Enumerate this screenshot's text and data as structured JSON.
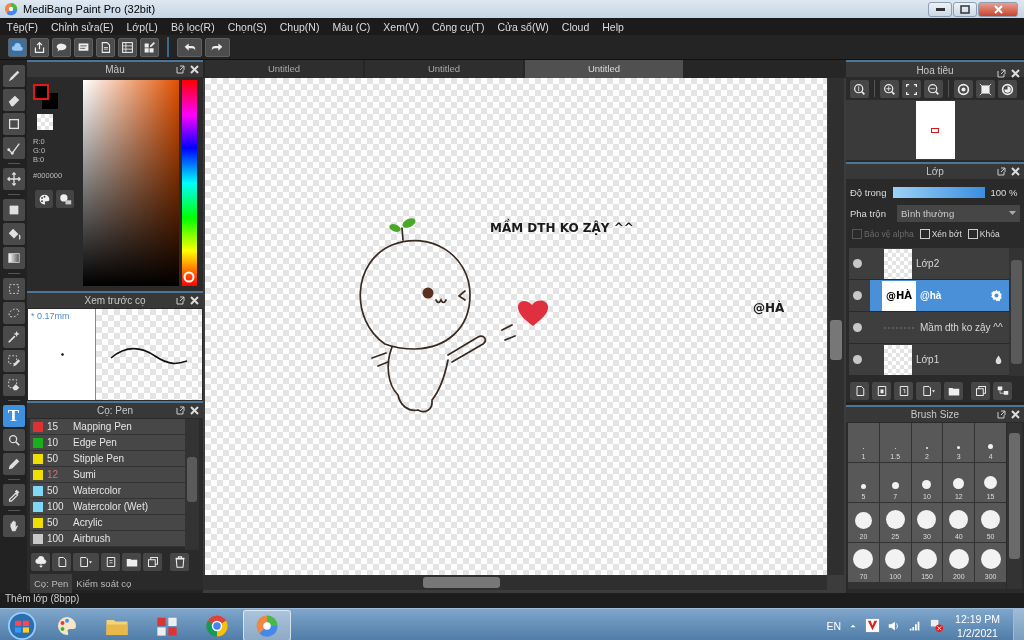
{
  "window": {
    "title": "MediBang Paint Pro (32bit)"
  },
  "menu": [
    "Tệp(F)",
    "Chỉnh sửa(E)",
    "Lớp(L)",
    "Bộ lọc(R)",
    "Chọn(S)",
    "Chụp(N)",
    "Màu (C)",
    "Xem(V)",
    "Công cụ(T)",
    "Cửa sổ(W)",
    "Cloud",
    "Help"
  ],
  "tools": [
    {
      "kind": "brush",
      "selected": false
    },
    {
      "kind": "eraser",
      "selected": false
    },
    {
      "kind": "rectangle",
      "selected": false
    },
    {
      "kind": "dot-line",
      "selected": false
    },
    {
      "kind": "move",
      "selected": false
    },
    {
      "kind": "fill-rect",
      "selected": false
    },
    {
      "kind": "bucket",
      "selected": false
    },
    {
      "kind": "gradient",
      "selected": false
    },
    {
      "kind": "select",
      "selected": false
    },
    {
      "kind": "lasso",
      "selected": false
    },
    {
      "kind": "magic-wand",
      "selected": false
    },
    {
      "kind": "select-pen",
      "selected": false
    },
    {
      "kind": "select-eraser",
      "selected": false
    },
    {
      "kind": "text",
      "label": "T",
      "selected": true
    },
    {
      "kind": "operation",
      "selected": false
    },
    {
      "kind": "pen",
      "selected": false
    },
    {
      "kind": "eyedropper",
      "selected": false
    },
    {
      "kind": "hand",
      "selected": false
    }
  ],
  "color_panel": {
    "title": "Màu",
    "r": "R:0",
    "g": "G:0",
    "b": "B:0",
    "hex": "#000000",
    "hue": {
      "level": 0
    }
  },
  "preview_panel": {
    "title": "Xem trước cọ",
    "size": "* 0.17mm"
  },
  "brushes": {
    "title": "Cọ: Pen",
    "items": [
      {
        "size": "15",
        "name": "Mapping Pen",
        "color": "#e03030",
        "size_highlight": false
      },
      {
        "size": "10",
        "name": "Edge Pen",
        "color": "#18b018",
        "size_highlight": false
      },
      {
        "size": "50",
        "name": "Stipple Pen",
        "color": "#f0e000",
        "size_highlight": false
      },
      {
        "size": "12",
        "name": "Sumi",
        "color": "#f0e000",
        "size_highlight": true
      },
      {
        "size": "50",
        "name": "Watercolor",
        "color": "#80d8f8",
        "size_highlight": false
      },
      {
        "size": "100",
        "name": "Watercolor (Wet)",
        "color": "#80d8f8",
        "size_highlight": false
      },
      {
        "size": "50",
        "name": "Acrylic",
        "color": "#f0e000",
        "size_highlight": false
      },
      {
        "size": "100",
        "name": "Airbrush",
        "color": "#c8c8c8",
        "size_highlight": false
      }
    ],
    "tabs": [
      {
        "label": "Cọ: Pen",
        "selected": true
      },
      {
        "label": "Kiểm soát cọ",
        "selected": false
      }
    ]
  },
  "canvas": {
    "tabs": [
      {
        "label": "Untitled",
        "selected": false
      },
      {
        "label": "Untitled",
        "selected": false
      },
      {
        "label": "Untitled",
        "selected": true
      }
    ],
    "texts": [
      "MẦM DTH KO ZẬY ^^",
      "@HÀ"
    ]
  },
  "navigator": {
    "title": "Hoa tiêu"
  },
  "layers": {
    "title": "Lớp",
    "opacity_label": "Độ trong",
    "opacity": {
      "level": 1,
      "reading": "100 %"
    },
    "blend_label": "Pha trộn",
    "blend": "Bình thường",
    "options": [
      {
        "label": "Bảo vệ alpha",
        "checked": false,
        "disabled": true
      },
      {
        "label": "Xén bớt",
        "checked": false,
        "disabled": false
      },
      {
        "label": "Khóa",
        "checked": false,
        "disabled": false
      }
    ],
    "items": [
      {
        "name": "Lớp2",
        "thumbnail": {
          "kind": "blank"
        },
        "selected": false
      },
      {
        "name": "@hà",
        "thumbnail": {
          "kind": "text",
          "text": "@HÀ"
        },
        "badge": {
          "kind": "gear"
        },
        "selected": true
      },
      {
        "name": "Mầm dth ko zậy ^^",
        "thumbnail": {
          "kind": "line"
        },
        "selected": false
      },
      {
        "name": "Lớp1",
        "thumbnail": {
          "kind": "blank"
        },
        "badge": {
          "kind": "drop"
        },
        "selected": false
      }
    ]
  },
  "brush_size": {
    "title": "Brush Size",
    "sizes": [
      "1",
      "1.5",
      "2",
      "3",
      "4",
      "5",
      "7",
      "10",
      "12",
      "15",
      "20",
      "25",
      "30",
      "40",
      "50",
      "70",
      "100",
      "150",
      "200",
      "300"
    ]
  },
  "status_bar": "Thêm lớp (8bpp)",
  "taskbar": {
    "language": "EN",
    "time": "12:19 PM",
    "date": "1/2/2021"
  }
}
